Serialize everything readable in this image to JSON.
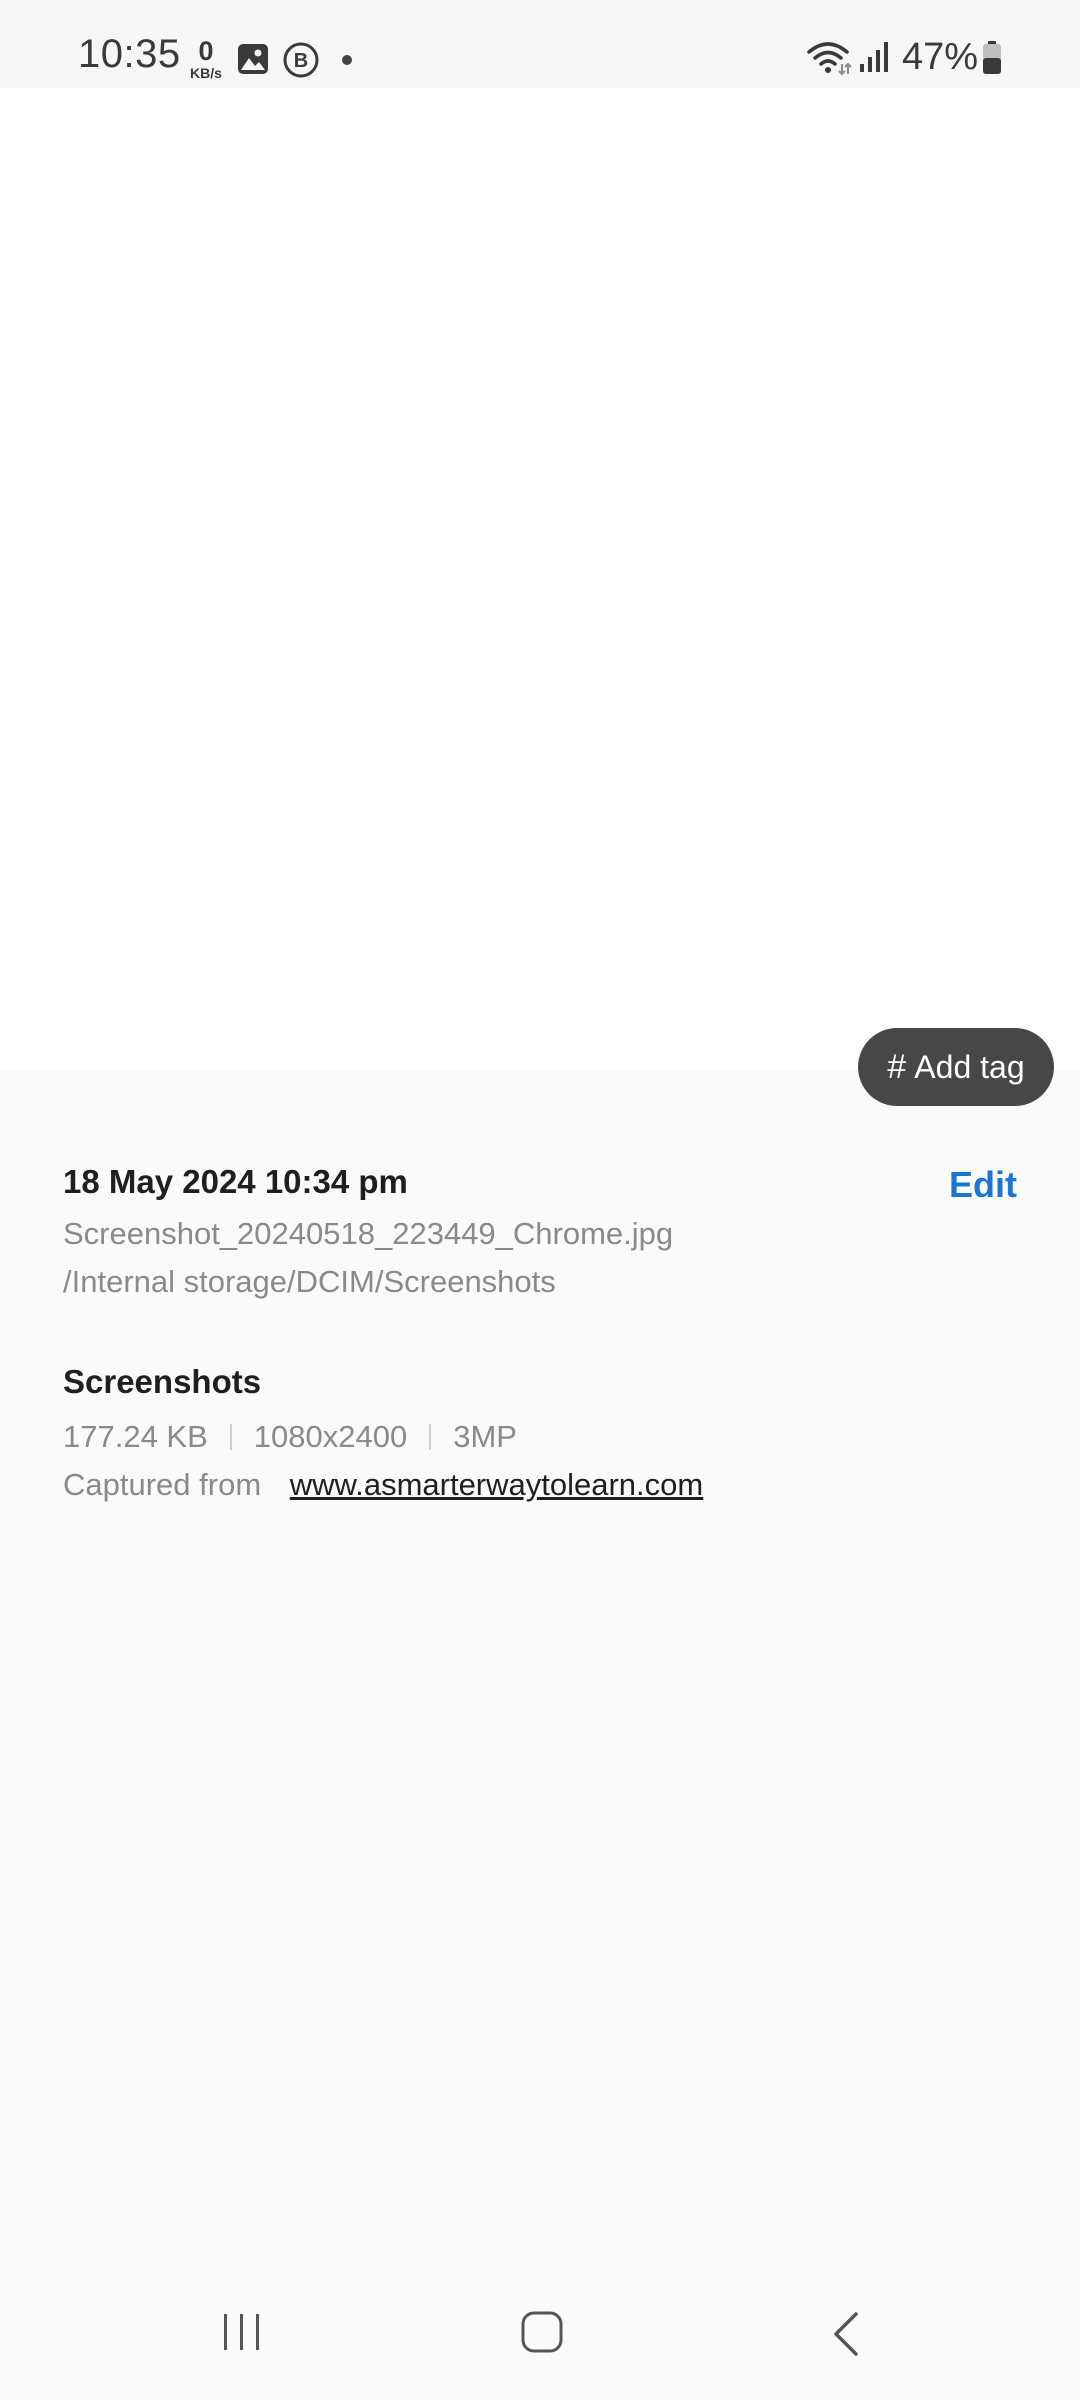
{
  "status_bar": {
    "time": "10:35",
    "net_speed_value": "0",
    "net_speed_unit": "KB/s",
    "battery_percent": "47%",
    "icons": [
      "gallery-icon",
      "b-icon",
      "dot-icon",
      "wifi-icon",
      "signal-icon",
      "battery-icon"
    ]
  },
  "image_area": {
    "add_tag_label": "Add tag",
    "add_tag_hash": "#"
  },
  "details": {
    "date_time": "18 May 2024 10:34 pm",
    "edit_label": "Edit",
    "file_name": "Screenshot_20240518_223449_Chrome.jpg",
    "file_path": "/Internal storage/DCIM/Screenshots",
    "album": "Screenshots",
    "file_size": "177.24 KB",
    "resolution": "1080x2400",
    "megapixels": "3MP",
    "captured_from_label": "Captured from",
    "captured_from_url": "www.asmarterwaytolearn.com"
  },
  "colors": {
    "accent": "#1976d2",
    "tag_button_bg": "#474747",
    "background": "#fafafa",
    "secondary_text": "#8a8a8a"
  },
  "nav_bar": {
    "icons": [
      "recents-icon",
      "home-icon",
      "back-icon"
    ]
  }
}
